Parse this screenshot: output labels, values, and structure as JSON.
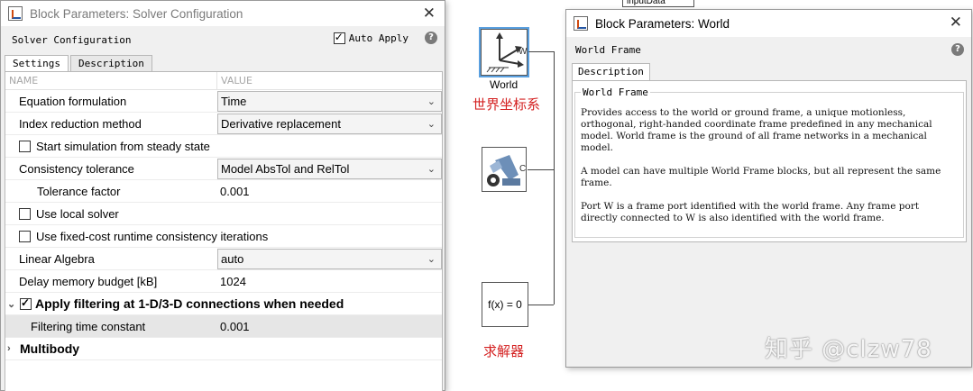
{
  "solver_dialog": {
    "title": "Block Parameters: Solver Configuration",
    "close_glyph": "✕",
    "block_name": "Solver Configuration",
    "auto_apply_label": "Auto Apply",
    "auto_apply_checked": true,
    "help_glyph": "?",
    "tabs": [
      "Settings",
      "Description"
    ],
    "columns": {
      "name": "NAME",
      "value": "VALUE"
    },
    "rows": {
      "equation_formulation": {
        "label": "Equation formulation",
        "value": "Time"
      },
      "index_reduction": {
        "label": "Index reduction method",
        "value": "Derivative replacement"
      },
      "steady_state": {
        "label": "Start simulation from steady state",
        "checked": false
      },
      "consistency_tolerance": {
        "label": "Consistency tolerance",
        "value": "Model AbsTol and RelTol"
      },
      "tolerance_factor": {
        "label": "Tolerance factor",
        "value": "0.001"
      },
      "local_solver": {
        "label": "Use local solver",
        "checked": false
      },
      "fixed_cost": {
        "label": "Use fixed-cost runtime consistency iterations",
        "checked": false
      },
      "linear_algebra": {
        "label": "Linear Algebra",
        "value": "auto"
      },
      "delay_memory": {
        "label": "Delay memory budget [kB]",
        "value": "1024"
      },
      "apply_filtering": {
        "label": "Apply filtering at 1-D/3-D connections when needed",
        "checked": true
      },
      "filtering_time": {
        "label": "Filtering time constant",
        "value": "0.001"
      },
      "multibody": {
        "label": "Multibody"
      }
    }
  },
  "canvas": {
    "top_block_label": "inputData",
    "world_block": {
      "caption": "World",
      "port": "W",
      "cn_label": "世界坐标系"
    },
    "solver_block": {
      "port": "C"
    },
    "fx_block": {
      "text": "f(x) = 0",
      "cn_label": "求解器"
    }
  },
  "world_dialog": {
    "title": "Block Parameters: World",
    "close_glyph": "✕",
    "block_name": "World Frame",
    "help_glyph": "?",
    "tab": "Description",
    "group_title": "World Frame",
    "paragraphs": [
      "Provides access to the world or ground frame, a unique motionless, orthogonal, right-handed coordinate frame predefined in any mechanical model. World frame is the ground of all frame networks in a mechanical model.",
      "A model can have multiple World Frame blocks, but all represent the same frame.",
      "Port W is a frame port identified with the world frame. Any frame port directly connected to W is also identified with the world frame."
    ]
  },
  "watermark": "知乎 @clzw78"
}
